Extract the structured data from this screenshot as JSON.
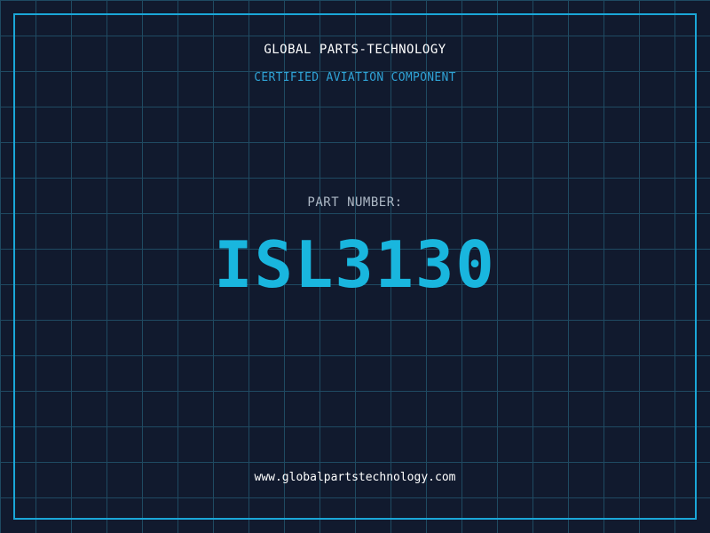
{
  "header": {
    "company_name": "GLOBAL PARTS-TECHNOLOGY",
    "tagline": "CERTIFIED AVIATION COMPONENT"
  },
  "part": {
    "label": "PART NUMBER:",
    "number": "ISL3130"
  },
  "footer": {
    "website": "www.globalpartstechnology.com"
  },
  "colors": {
    "background": "#111a2e",
    "grid": "#1f4a62",
    "frame": "#1aa7d8",
    "accent": "#19b6de",
    "tagline": "#2fa3d6"
  }
}
